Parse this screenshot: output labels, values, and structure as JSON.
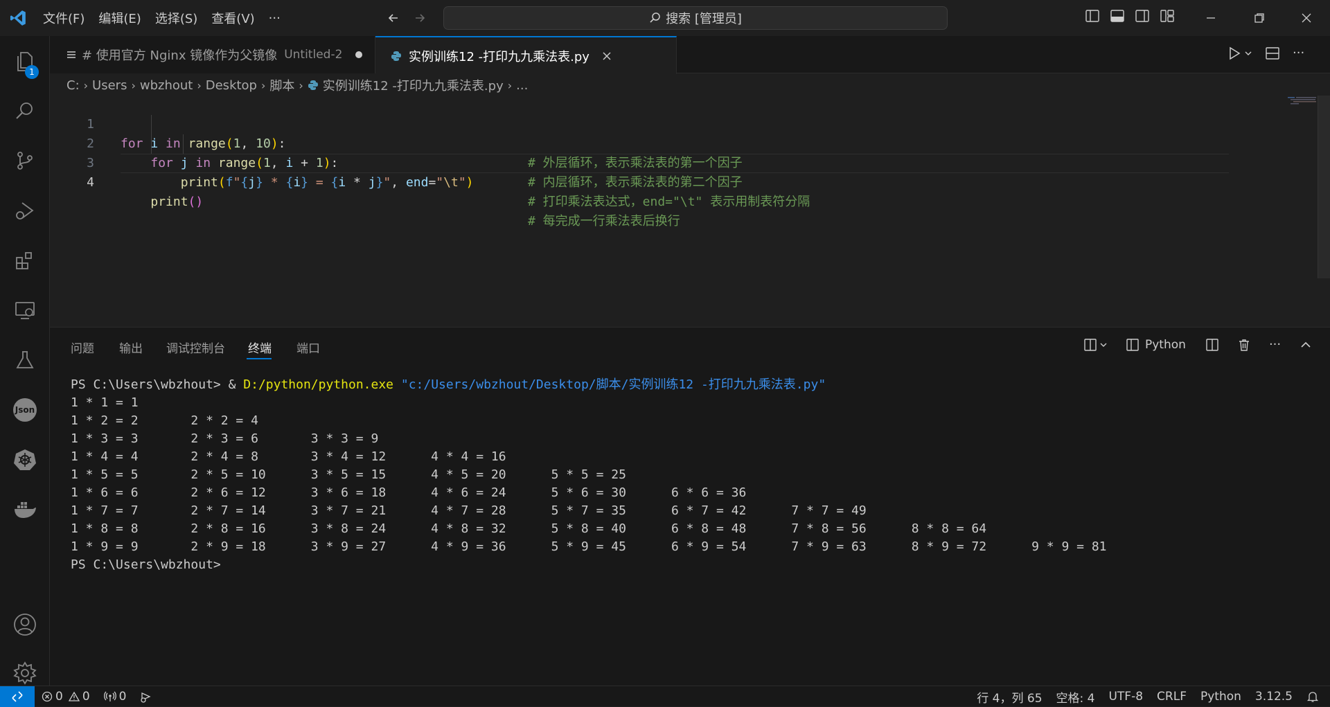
{
  "titlebar": {
    "menus": [
      "文件(F)",
      "编辑(E)",
      "选择(S)",
      "查看(V)",
      "···"
    ],
    "search_text": "搜索 [管理员]"
  },
  "activitybar": {
    "explorer_badge": "1",
    "json_icon_label": "Json"
  },
  "tabs": [
    {
      "label": "# 使用官方 Nginx 镜像作为父镜像",
      "subtitle": "Untitled-2",
      "modified": true
    },
    {
      "label": "实例训练12 -打印九九乘法表.py",
      "active": true
    }
  ],
  "breadcrumb": [
    "C:",
    "Users",
    "wbzhout",
    "Desktop",
    "脚本",
    "实例训练12 -打印九九乘法表.py",
    "..."
  ],
  "editor": {
    "line_numbers": [
      "1",
      "2",
      "3",
      "4"
    ],
    "comments": [
      "# 外层循环，表示乘法表的第一个因子",
      "# 内层循环，表示乘法表的第二个因子",
      "# 打印乘法表达式，end=\"\\t\" 表示用制表符分隔",
      "# 每完成一行乘法表后换行"
    ]
  },
  "panel": {
    "tabs": [
      "问题",
      "输出",
      "调试控制台",
      "终端",
      "端口"
    ],
    "active_tab": "终端",
    "terminal_profile": "Python",
    "terminal": {
      "prompt": "PS C:\\Users\\wbzhout>",
      "command_amp": " & ",
      "command_exe": "D:/python/python.exe",
      "command_arg": "\"c:/Users/wbzhout/Desktop/脚本/实例训练12 -打印九九乘法表.py\"",
      "output_lines": [
        "1 * 1 = 1",
        "1 * 2 = 2       2 * 2 = 4",
        "1 * 3 = 3       2 * 3 = 6       3 * 3 = 9",
        "1 * 4 = 4       2 * 4 = 8       3 * 4 = 12      4 * 4 = 16",
        "1 * 5 = 5       2 * 5 = 10      3 * 5 = 15      4 * 5 = 20      5 * 5 = 25",
        "1 * 6 = 6       2 * 6 = 12      3 * 6 = 18      4 * 6 = 24      5 * 6 = 30      6 * 6 = 36",
        "1 * 7 = 7       2 * 7 = 14      3 * 7 = 21      4 * 7 = 28      5 * 7 = 35      6 * 7 = 42      7 * 7 = 49",
        "1 * 8 = 8       2 * 8 = 16      3 * 8 = 24      4 * 8 = 32      5 * 8 = 40      6 * 8 = 48      7 * 8 = 56      8 * 8 = 64",
        "1 * 9 = 9       2 * 9 = 18      3 * 9 = 27      4 * 9 = 36      5 * 9 = 45      6 * 9 = 54      7 * 9 = 63      8 * 9 = 72      9 * 9 = 81"
      ],
      "final_prompt": "PS C:\\Users\\wbzhout>"
    }
  },
  "statusbar": {
    "errors": "0",
    "warnings": "0",
    "ports": "0",
    "cursor_position": "行 4，列 65",
    "spaces": "空格: 4",
    "encoding": "UTF-8",
    "eol": "CRLF",
    "language": "Python",
    "python_version": "3.12.5"
  },
  "colors": {
    "accent": "#0078d4",
    "editor_bg": "#1f1f1f",
    "sidebar_bg": "#181818"
  }
}
